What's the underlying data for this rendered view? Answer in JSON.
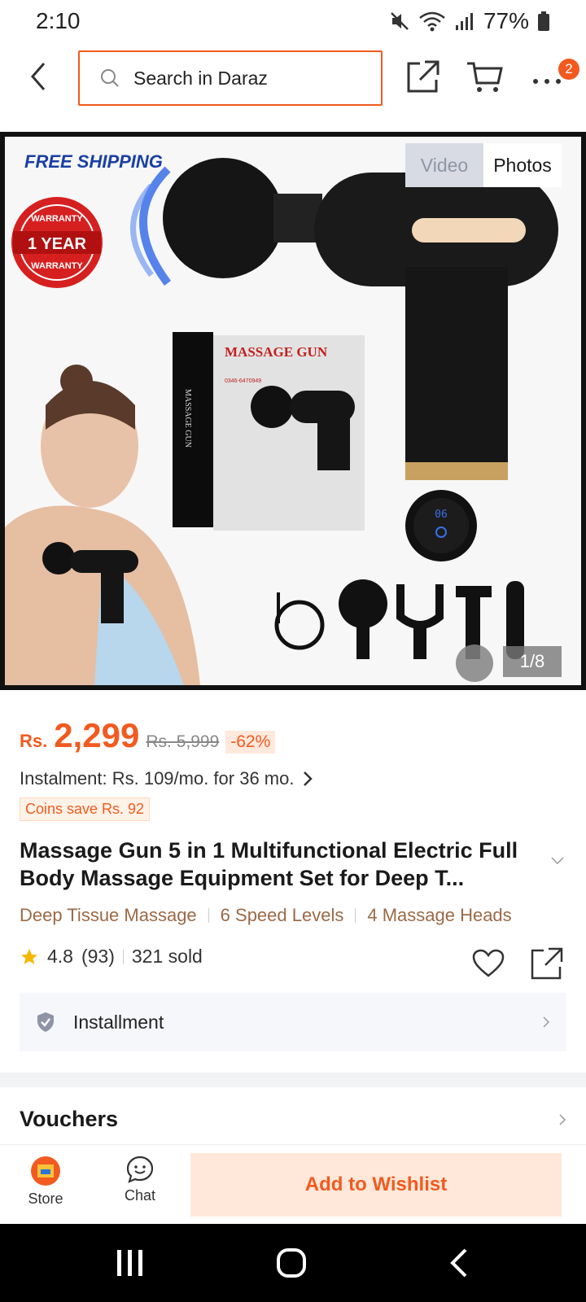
{
  "status_bar": {
    "time": "2:10",
    "battery": "77%"
  },
  "nav": {
    "search_placeholder": "Search in Daraz",
    "cart_badge": "2"
  },
  "gallery": {
    "tabs": [
      "Video",
      "Photos"
    ],
    "counter": "1/8",
    "promo": {
      "free_shipping": "FREE SHIPPING",
      "warranty": "1 YEAR",
      "warranty_ring": "WARRANTY",
      "box_title": "MASSAGE GUN",
      "box_phone": "0346-6470949",
      "box_side": "MASSAGE GUN",
      "display_num": "06"
    }
  },
  "product": {
    "currency": "Rs.",
    "price": "2,299",
    "old_price": "Rs. 5,999",
    "discount": "-62%",
    "instalment": "Instalment: Rs. 109/mo. for 36 mo.",
    "coins": "Coins save Rs. 92",
    "title": "Massage Gun 5 in 1 Multifunctional Electric Full Body Massage Equipment Set for Deep T...",
    "features": [
      "Deep Tissue Massage",
      "6 Speed Levels",
      "4 Massage Heads"
    ],
    "rating": "4.8",
    "reviews": "(93)",
    "sold": "321 sold"
  },
  "installment": {
    "label": "Installment"
  },
  "vouchers": {
    "label": "Vouchers"
  },
  "action_bar": {
    "store": "Store",
    "chat": "Chat",
    "wishlist": "Add to Wishlist"
  },
  "colors": {
    "accent": "#f25a1f",
    "feature_text": "#9b6a47"
  }
}
